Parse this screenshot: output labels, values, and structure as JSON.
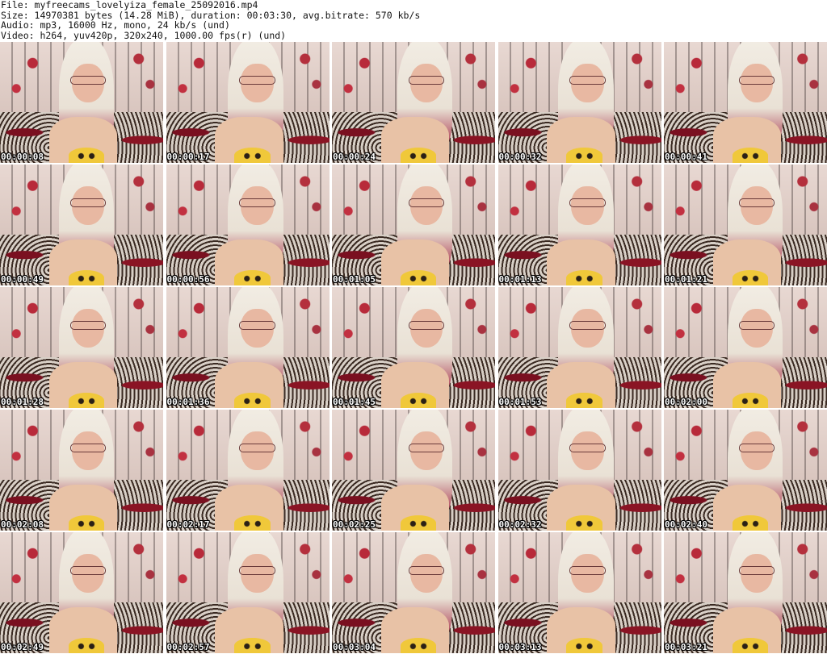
{
  "header": {
    "file_line": "File: myfreecams_lovelyiza_female_25092016.mp4",
    "size_line": "Size: 14970381 bytes (14.28 MiB), duration: 00:03:30, avg.bitrate: 570 kb/s",
    "audio_line": "Audio: mp3, 16000 Hz, mono, 24 kb/s (und)",
    "video_line": "Video: h264, yuv420p, 320x240, 1000.00 fps(r) (und)"
  },
  "thumbnails": [
    {
      "timestamp": "00:00:08"
    },
    {
      "timestamp": "00:00:17"
    },
    {
      "timestamp": "00:00:24"
    },
    {
      "timestamp": "00:00:32"
    },
    {
      "timestamp": "00:00:41"
    },
    {
      "timestamp": "00:00:49"
    },
    {
      "timestamp": "00:00:56"
    },
    {
      "timestamp": "00:01:05"
    },
    {
      "timestamp": "00:01:13"
    },
    {
      "timestamp": "00:01:21"
    },
    {
      "timestamp": "00:01:28"
    },
    {
      "timestamp": "00:01:36"
    },
    {
      "timestamp": "00:01:45"
    },
    {
      "timestamp": "00:01:53"
    },
    {
      "timestamp": "00:02:00"
    },
    {
      "timestamp": "00:02:08"
    },
    {
      "timestamp": "00:02:17"
    },
    {
      "timestamp": "00:02:25"
    },
    {
      "timestamp": "00:02:32"
    },
    {
      "timestamp": "00:02:40"
    },
    {
      "timestamp": "00:02:49"
    },
    {
      "timestamp": "00:02:57"
    },
    {
      "timestamp": "00:03:04"
    },
    {
      "timestamp": "00:03:13"
    },
    {
      "timestamp": "00:03:21"
    }
  ]
}
